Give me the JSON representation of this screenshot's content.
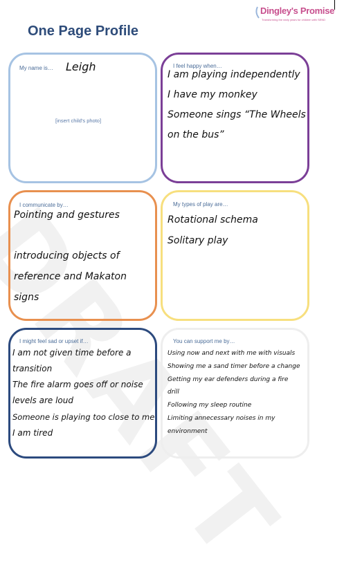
{
  "header": {
    "logo_name": "Dingley's Promise",
    "logo_tagline": "Transforming the early years for children with SEND",
    "title": "One Page Profile"
  },
  "watermark": "DRAFT",
  "box_name": {
    "label": "My name is…",
    "value": "Leigh",
    "photo_placeholder": "[insert child's photo]"
  },
  "box_happy": {
    "label": "I feel happy when…",
    "lines": [
      "I am playing independently",
      "I have my monkey",
      "Someone sings “The Wheels",
      "on the bus”"
    ]
  },
  "box_communicate": {
    "label": "I communicate by…",
    "lines": [
      "Pointing and gestures",
      "introducing objects of",
      "reference and Makaton",
      "signs"
    ]
  },
  "box_play": {
    "label": "My types of play are…",
    "lines": [
      "Rotational schema",
      "Solitary play"
    ]
  },
  "box_sad": {
    "label": "I might feel sad or upset if…",
    "lines": [
      "I am not given time before a",
      "transition",
      "The fire alarm goes off or noise",
      "levels are loud",
      "Someone is playing too close to me",
      "I am tired"
    ]
  },
  "box_support": {
    "label": "You can support me by…",
    "lines": [
      "Using now and next with me with visuals",
      "Showing me a sand timer before a change",
      "Getting my ear defenders during a fire",
      "drill",
      "Following my sleep routine",
      "Limiting annecessary noises in my",
      "environment"
    ]
  },
  "colors": {
    "title": "#2e4c7a",
    "name_border": "#a6c3e3",
    "happy_border": "#7b3f97",
    "communicate_border": "#e8904f",
    "play_border": "#f7df7e",
    "sad_border": "#2c4a7e",
    "support_border": "#eeeeee"
  }
}
